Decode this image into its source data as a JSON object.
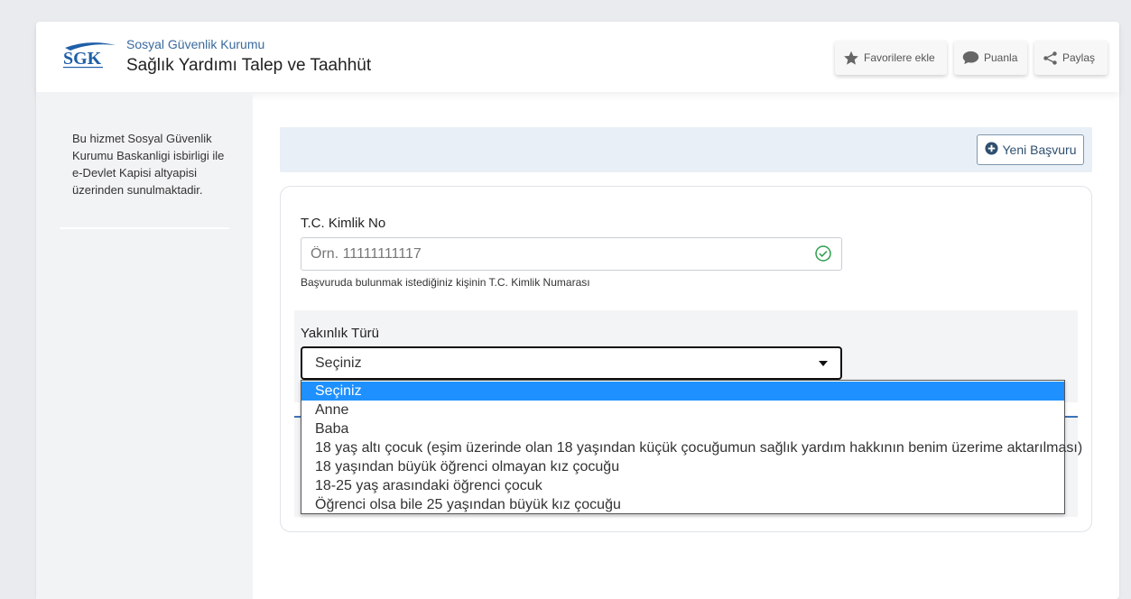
{
  "header": {
    "logo_text": "SGK",
    "institution": "Sosyal Güvenlik Kurumu",
    "title": "Sağlık Yardımı Talep ve Taahhüt",
    "buttons": {
      "favorite": "Favorilere ekle",
      "rate": "Puanla",
      "share": "Paylaş"
    }
  },
  "sidebar": {
    "info_text": "Bu hizmet Sosyal Güvenlik Kurumu Baskanligi isbirligi ile e-Devlet Kapisi altyapisi üzerinden sunulmaktadir."
  },
  "toolbar": {
    "new_application": "Yeni Başvuru"
  },
  "form": {
    "tc_label": "T.C. Kimlik No",
    "tc_placeholder": "Örn. 11111111117",
    "tc_help": "Başvuruda bulunmak istediğiniz kişinin T.C. Kimlik Numarası",
    "relation_label": "Yakınlık Türü",
    "relation_selected": "Seçiniz",
    "relation_options": [
      "Seçiniz",
      "Anne",
      "Baba",
      "18 yaş altı çocuk (eşim üzerinde olan 18 yaşından küçük çocuğumun sağlık yardım hakkının benim üzerime aktarılması)",
      "18 yaşından büyük öğrenci olmayan kız çocuğu",
      "18-25 yaş arasındaki öğrenci çocuk",
      "Öğrenci olsa bile 25 yaşından büyük kız çocuğu"
    ]
  },
  "colors": {
    "accent": "#1e90ff",
    "brand": "#3a6a9e",
    "valid": "#2e9e4f"
  }
}
